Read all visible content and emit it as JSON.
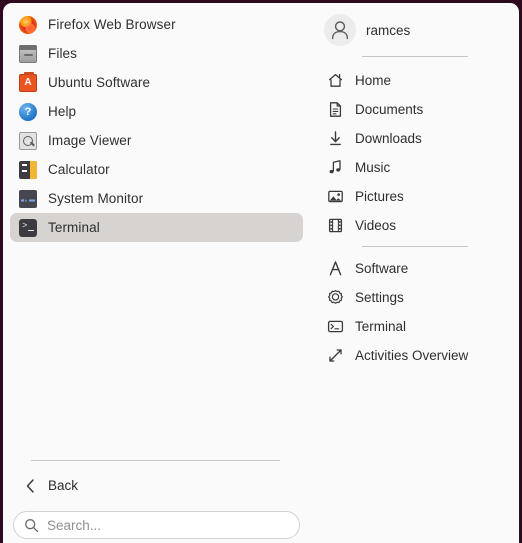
{
  "window": {
    "title": "Application Menu",
    "border_color": "#2d0a1e",
    "background_color": "#fafafa",
    "selection_color": "#d6d3d1"
  },
  "applications": [
    {
      "label": "Firefox Web Browser",
      "icon": "firefox-icon",
      "selected": false
    },
    {
      "label": "Files",
      "icon": "files-icon",
      "selected": false
    },
    {
      "label": "Ubuntu Software",
      "icon": "ubuntu-software-icon",
      "selected": false
    },
    {
      "label": "Help",
      "icon": "help-icon",
      "selected": false
    },
    {
      "label": "Image Viewer",
      "icon": "image-viewer-icon",
      "selected": false
    },
    {
      "label": "Calculator",
      "icon": "calculator-icon",
      "selected": false
    },
    {
      "label": "System Monitor",
      "icon": "system-monitor-icon",
      "selected": false
    },
    {
      "label": "Terminal",
      "icon": "terminal-icon",
      "selected": true
    }
  ],
  "back": {
    "label": "Back",
    "icon": "chevron-left-icon"
  },
  "search": {
    "value": "",
    "placeholder": "Search...",
    "icon": "search-icon"
  },
  "user": {
    "name": "ramces",
    "avatar_icon": "person-icon"
  },
  "places": [
    {
      "label": "Home",
      "icon": "home-icon"
    },
    {
      "label": "Documents",
      "icon": "document-icon"
    },
    {
      "label": "Downloads",
      "icon": "download-arrow-icon"
    },
    {
      "label": "Music",
      "icon": "music-note-icon"
    },
    {
      "label": "Pictures",
      "icon": "picture-icon"
    },
    {
      "label": "Videos",
      "icon": "film-strip-icon"
    }
  ],
  "actions": [
    {
      "label": "Software",
      "icon": "ubuntu-logo-icon"
    },
    {
      "label": "Settings",
      "icon": "gear-icon"
    },
    {
      "label": "Terminal",
      "icon": "terminal-prompt-icon"
    },
    {
      "label": "Activities Overview",
      "icon": "expand-arrows-icon"
    }
  ],
  "system_buttons": [
    {
      "name": "log-out",
      "icon": "logout-icon"
    },
    {
      "name": "lock-screen",
      "icon": "lock-icon"
    },
    {
      "name": "restart",
      "icon": "restart-icon"
    },
    {
      "name": "power-off",
      "icon": "power-icon"
    }
  ]
}
